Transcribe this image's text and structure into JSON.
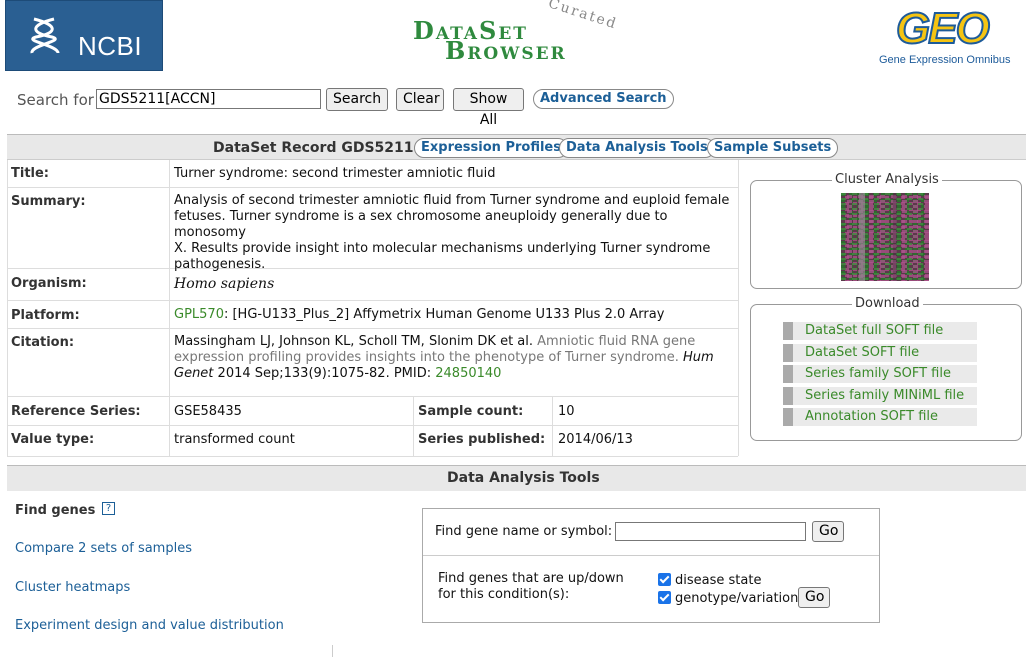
{
  "header": {
    "ncbi_text": "NCBI",
    "browser_line1": "DataSet",
    "browser_line2": "Browser",
    "browser_curated": "Curated",
    "geo_mark": "GEO",
    "geo_subtitle": "Gene Expression Omnibus"
  },
  "search": {
    "label": "Search for",
    "value": "GDS5211[ACCN]",
    "search_button": "Search",
    "clear_button": "Clear",
    "show_all_button": "Show All",
    "advanced_search": "Advanced Search"
  },
  "record": {
    "title": "DataSet Record GDS5211:",
    "tabs": [
      "Expression Profiles",
      "Data Analysis Tools",
      "Sample Subsets"
    ],
    "title_label": "Title:",
    "title_value": "Turner syndrome: second trimester amniotic fluid",
    "summary_label": "Summary:",
    "summary_lines": [
      "Analysis of second trimester amniotic fluid from Turner syndrome and euploid female",
      "fetuses. Turner syndrome is a sex chromosome aneuploidy generally due to monosomy",
      "X. Results provide insight into molecular mechanisms underlying Turner syndrome",
      "pathogenesis."
    ],
    "organism_label": "Organism:",
    "organism_value": "Homo sapiens",
    "platform_label": "Platform:",
    "platform_id": "GPL570",
    "platform_desc": ": [HG-U133_Plus_2] Affymetrix Human Genome U133 Plus 2.0 Array",
    "citation_label": "Citation:",
    "citation_authors": "Massingham LJ, Johnson KL, Scholl TM, Slonim DK et al.",
    "citation_title_a": "Amniotic fluid RNA gene",
    "citation_title_b": "expression profiling provides insights into the phenotype of Turner syndrome.",
    "citation_journal_a": "Hum",
    "citation_journal_b": "Genet",
    "citation_rest": "2014 Sep;133(9):1075-82. PMID:",
    "pmid": "24850140",
    "ref_series_label": "Reference Series:",
    "ref_series_value": "GSE58435",
    "sample_count_label": "Sample count:",
    "sample_count_value": "10",
    "value_type_label": "Value type:",
    "value_type_value": "transformed count",
    "series_published_label": "Series published:",
    "series_published_value": "2014/06/13"
  },
  "side": {
    "cluster_legend": "Cluster Analysis",
    "download_legend": "Download",
    "downloads": [
      "DataSet full SOFT file",
      "DataSet SOFT file",
      "Series family SOFT file",
      "Series family MINiML file",
      "Annotation SOFT file"
    ]
  },
  "tools": {
    "title": "Data Analysis Tools",
    "find_genes": "Find genes",
    "help_icon": "?",
    "compare": "Compare 2 sets of samples",
    "cluster": "Cluster heatmaps",
    "experiment": "Experiment design and value distribution",
    "find_gene_label": "Find gene name or symbol:",
    "find_gene_value": "",
    "go_label": "Go",
    "updown_line1": "Find genes that are up/down",
    "updown_line2": "for this condition(s):",
    "conditions": [
      "disease state",
      "genotype/variation"
    ]
  },
  "colors": {
    "link": "#1c5f97",
    "green_link": "#3a8a2a",
    "ncbi_blue": "#2a5f92"
  }
}
